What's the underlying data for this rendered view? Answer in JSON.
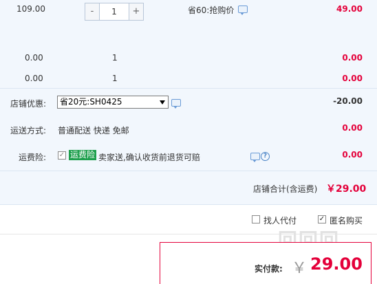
{
  "items": [
    {
      "unit_price": "109.00",
      "quantity": "1",
      "promo": "省60:抢购价",
      "subtotal": "49.00"
    },
    {
      "unit_price": "0.00",
      "quantity": "1",
      "subtotal": "0.00"
    },
    {
      "unit_price": "0.00",
      "quantity": "1",
      "subtotal": "0.00"
    }
  ],
  "qty_controls": {
    "minus": "-",
    "plus": "+"
  },
  "shop_discount": {
    "label": "店铺优惠:",
    "selected": "省20元:SH0425",
    "amount": "-20.00"
  },
  "shipping": {
    "label": "运送方式:",
    "method": "普通配送 快递 免邮",
    "amount": "0.00"
  },
  "freight_insurance": {
    "label": "运费险:",
    "tag": "运费险",
    "description": "卖家送,确认收货前退货可赔",
    "amount": "0.00",
    "checked": true
  },
  "shop_total": {
    "label": "店铺合计(含运费)",
    "amount": "￥29.00"
  },
  "options": {
    "pay_for_me": {
      "label": "找人代付",
      "checked": false
    },
    "anonymous": {
      "label": "匿名购买",
      "checked": true
    }
  },
  "payment": {
    "label": "实付款:",
    "currency": "￥",
    "amount": "29.00"
  },
  "colors": {
    "accent_red": "#e4003a",
    "panel_blue": "#f2f7fd",
    "tag_green": "#1e9f4d"
  }
}
